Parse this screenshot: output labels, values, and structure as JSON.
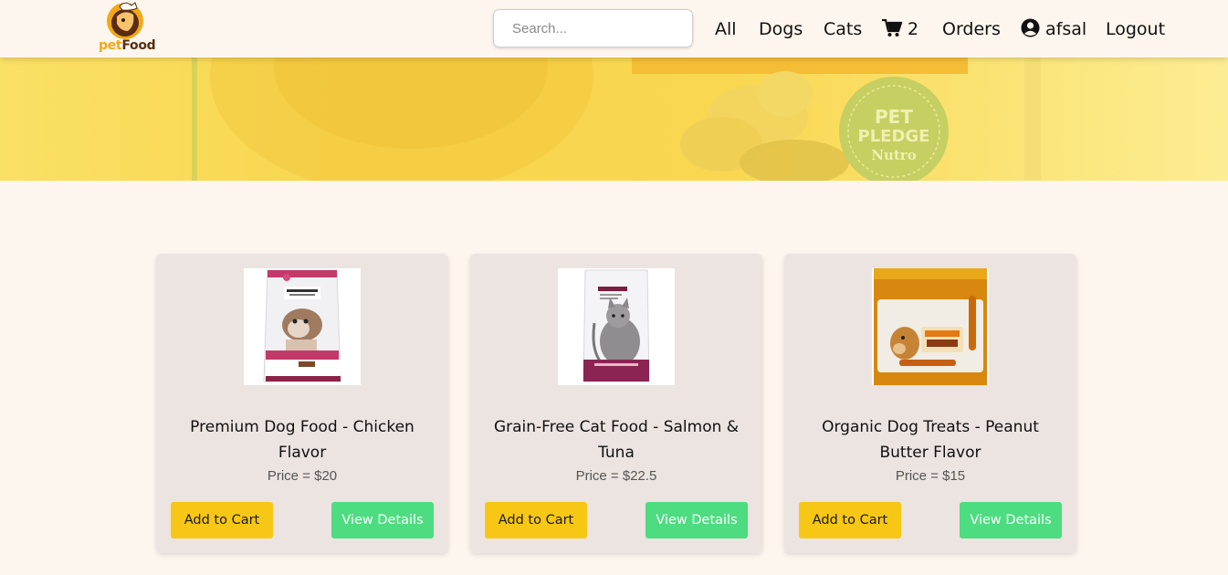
{
  "brand": {
    "logo_pet": "pet",
    "logo_food": "Food"
  },
  "search": {
    "placeholder": "Search..."
  },
  "nav": {
    "all": "All",
    "dogs": "Dogs",
    "cats": "Cats",
    "cart_count": "2",
    "orders": "Orders",
    "user": "afsal",
    "logout": "Logout"
  },
  "hero": {
    "badge_line1": "PET",
    "badge_line2": "PLEDGE",
    "badge_brand": "Nutro"
  },
  "products": [
    {
      "title": "Premium Dog Food - Chicken Flavor",
      "price": "Price = $20",
      "add_label": "Add to Cart",
      "view_label": "View Details"
    },
    {
      "title": "Grain-Free Cat Food - Salmon & Tuna",
      "price": "Price = $22.5",
      "add_label": "Add to Cart",
      "view_label": "View Details"
    },
    {
      "title": "Organic Dog Treats - Peanut Butter Flavor",
      "price": "Price = $15",
      "add_label": "Add to Cart",
      "view_label": "View Details"
    }
  ],
  "colors": {
    "background": "#fdf6ee",
    "card": "#ece4e1",
    "add_button": "#f7c715",
    "view_button": "#4ddc80",
    "logo_orange": "#f2a818",
    "logo_brown": "#5a2d12"
  }
}
